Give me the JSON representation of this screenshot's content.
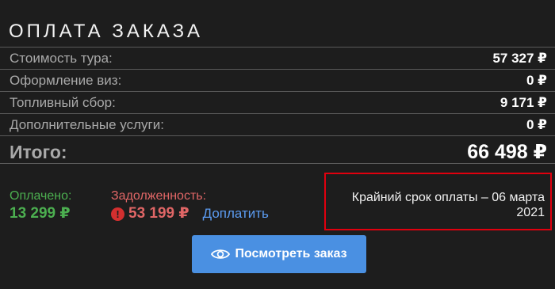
{
  "title": "ОПЛАТА ЗАКАЗА",
  "rows": [
    {
      "label": "Стоимость тура:",
      "value": "57 327 ₽"
    },
    {
      "label": "Оформление виз:",
      "value": "0 ₽"
    },
    {
      "label": "Топливный сбор:",
      "value": "9 171 ₽"
    },
    {
      "label": "Дополнительные услуги:",
      "value": "0 ₽"
    }
  ],
  "total": {
    "label": "Итого:",
    "value": "66 498 ₽"
  },
  "paid": {
    "label": "Оплачено:",
    "value": "13 299 ₽"
  },
  "debt": {
    "label": "Задолженность:",
    "value": "53 199 ₽",
    "pay_link": "Доплатить",
    "warn_icon": "!"
  },
  "deadline": {
    "line1": "Крайний срок оплаты – 06 марта",
    "line2": "2021"
  },
  "view_button": {
    "label": "Посмотреть заказ",
    "icon": "eye-icon"
  },
  "colors": {
    "paid": "#4caf50",
    "debt": "#e06666",
    "link": "#5b9bf0",
    "button": "#4a90e2",
    "highlight": "#e0000e"
  }
}
